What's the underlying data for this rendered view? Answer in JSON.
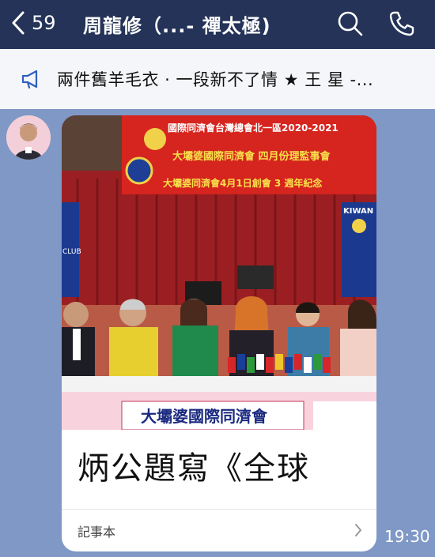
{
  "header": {
    "unread_count": "59",
    "title": "周龍修（...- 禪太極）",
    "title_display": "周龍修（...- 禪太極)"
  },
  "announcement": {
    "text": "兩件舊羊毛衣 · 一段新不了情 ★ 王 星 -..."
  },
  "message": {
    "photo": {
      "banner_line1": "國際同濟會台灣總會北一區2020-2021",
      "banner_line2": "大壩婆國際同濟會 四月份理監事會",
      "banner_line3": "大壩婆同濟會4月1日創會 3 週年紀念",
      "kiwanis_label": "KIWAN",
      "club_label": "CLUB",
      "table_banner": "大壩婆國際同濟會"
    },
    "title": "炳公題寫《全球",
    "footer_label": "記事本",
    "timestamp": "19:30"
  },
  "colors": {
    "topbar": "#243357",
    "chat_background": "#7f98c6",
    "announcement_bg": "#f5f6f9",
    "card_bg": "#ffffff"
  },
  "icons": {
    "back": "chevron-left-icon",
    "search": "search-icon",
    "call": "phone-icon",
    "announcement": "megaphone-icon",
    "footer": "chevron-right-icon"
  }
}
